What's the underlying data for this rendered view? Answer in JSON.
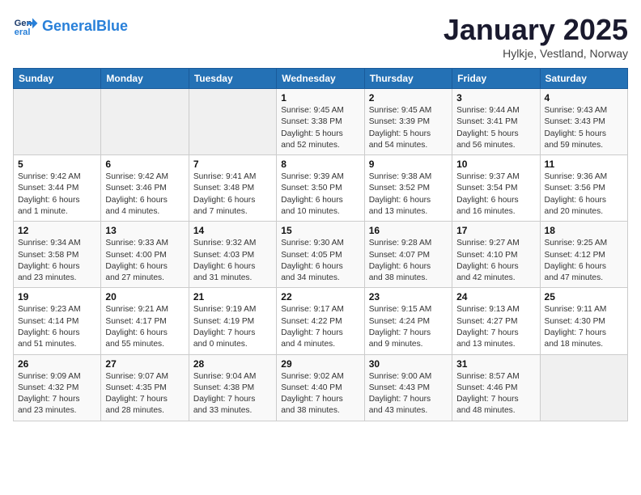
{
  "header": {
    "logo_general": "General",
    "logo_blue": "Blue",
    "month": "January 2025",
    "location": "Hylkje, Vestland, Norway"
  },
  "days_of_week": [
    "Sunday",
    "Monday",
    "Tuesday",
    "Wednesday",
    "Thursday",
    "Friday",
    "Saturday"
  ],
  "weeks": [
    [
      {
        "day": "",
        "info": ""
      },
      {
        "day": "",
        "info": ""
      },
      {
        "day": "",
        "info": ""
      },
      {
        "day": "1",
        "info": "Sunrise: 9:45 AM\nSunset: 3:38 PM\nDaylight: 5 hours\nand 52 minutes."
      },
      {
        "day": "2",
        "info": "Sunrise: 9:45 AM\nSunset: 3:39 PM\nDaylight: 5 hours\nand 54 minutes."
      },
      {
        "day": "3",
        "info": "Sunrise: 9:44 AM\nSunset: 3:41 PM\nDaylight: 5 hours\nand 56 minutes."
      },
      {
        "day": "4",
        "info": "Sunrise: 9:43 AM\nSunset: 3:43 PM\nDaylight: 5 hours\nand 59 minutes."
      }
    ],
    [
      {
        "day": "5",
        "info": "Sunrise: 9:42 AM\nSunset: 3:44 PM\nDaylight: 6 hours\nand 1 minute."
      },
      {
        "day": "6",
        "info": "Sunrise: 9:42 AM\nSunset: 3:46 PM\nDaylight: 6 hours\nand 4 minutes."
      },
      {
        "day": "7",
        "info": "Sunrise: 9:41 AM\nSunset: 3:48 PM\nDaylight: 6 hours\nand 7 minutes."
      },
      {
        "day": "8",
        "info": "Sunrise: 9:39 AM\nSunset: 3:50 PM\nDaylight: 6 hours\nand 10 minutes."
      },
      {
        "day": "9",
        "info": "Sunrise: 9:38 AM\nSunset: 3:52 PM\nDaylight: 6 hours\nand 13 minutes."
      },
      {
        "day": "10",
        "info": "Sunrise: 9:37 AM\nSunset: 3:54 PM\nDaylight: 6 hours\nand 16 minutes."
      },
      {
        "day": "11",
        "info": "Sunrise: 9:36 AM\nSunset: 3:56 PM\nDaylight: 6 hours\nand 20 minutes."
      }
    ],
    [
      {
        "day": "12",
        "info": "Sunrise: 9:34 AM\nSunset: 3:58 PM\nDaylight: 6 hours\nand 23 minutes."
      },
      {
        "day": "13",
        "info": "Sunrise: 9:33 AM\nSunset: 4:00 PM\nDaylight: 6 hours\nand 27 minutes."
      },
      {
        "day": "14",
        "info": "Sunrise: 9:32 AM\nSunset: 4:03 PM\nDaylight: 6 hours\nand 31 minutes."
      },
      {
        "day": "15",
        "info": "Sunrise: 9:30 AM\nSunset: 4:05 PM\nDaylight: 6 hours\nand 34 minutes."
      },
      {
        "day": "16",
        "info": "Sunrise: 9:28 AM\nSunset: 4:07 PM\nDaylight: 6 hours\nand 38 minutes."
      },
      {
        "day": "17",
        "info": "Sunrise: 9:27 AM\nSunset: 4:10 PM\nDaylight: 6 hours\nand 42 minutes."
      },
      {
        "day": "18",
        "info": "Sunrise: 9:25 AM\nSunset: 4:12 PM\nDaylight: 6 hours\nand 47 minutes."
      }
    ],
    [
      {
        "day": "19",
        "info": "Sunrise: 9:23 AM\nSunset: 4:14 PM\nDaylight: 6 hours\nand 51 minutes."
      },
      {
        "day": "20",
        "info": "Sunrise: 9:21 AM\nSunset: 4:17 PM\nDaylight: 6 hours\nand 55 minutes."
      },
      {
        "day": "21",
        "info": "Sunrise: 9:19 AM\nSunset: 4:19 PM\nDaylight: 7 hours\nand 0 minutes."
      },
      {
        "day": "22",
        "info": "Sunrise: 9:17 AM\nSunset: 4:22 PM\nDaylight: 7 hours\nand 4 minutes."
      },
      {
        "day": "23",
        "info": "Sunrise: 9:15 AM\nSunset: 4:24 PM\nDaylight: 7 hours\nand 9 minutes."
      },
      {
        "day": "24",
        "info": "Sunrise: 9:13 AM\nSunset: 4:27 PM\nDaylight: 7 hours\nand 13 minutes."
      },
      {
        "day": "25",
        "info": "Sunrise: 9:11 AM\nSunset: 4:30 PM\nDaylight: 7 hours\nand 18 minutes."
      }
    ],
    [
      {
        "day": "26",
        "info": "Sunrise: 9:09 AM\nSunset: 4:32 PM\nDaylight: 7 hours\nand 23 minutes."
      },
      {
        "day": "27",
        "info": "Sunrise: 9:07 AM\nSunset: 4:35 PM\nDaylight: 7 hours\nand 28 minutes."
      },
      {
        "day": "28",
        "info": "Sunrise: 9:04 AM\nSunset: 4:38 PM\nDaylight: 7 hours\nand 33 minutes."
      },
      {
        "day": "29",
        "info": "Sunrise: 9:02 AM\nSunset: 4:40 PM\nDaylight: 7 hours\nand 38 minutes."
      },
      {
        "day": "30",
        "info": "Sunrise: 9:00 AM\nSunset: 4:43 PM\nDaylight: 7 hours\nand 43 minutes."
      },
      {
        "day": "31",
        "info": "Sunrise: 8:57 AM\nSunset: 4:46 PM\nDaylight: 7 hours\nand 48 minutes."
      },
      {
        "day": "",
        "info": ""
      }
    ]
  ]
}
